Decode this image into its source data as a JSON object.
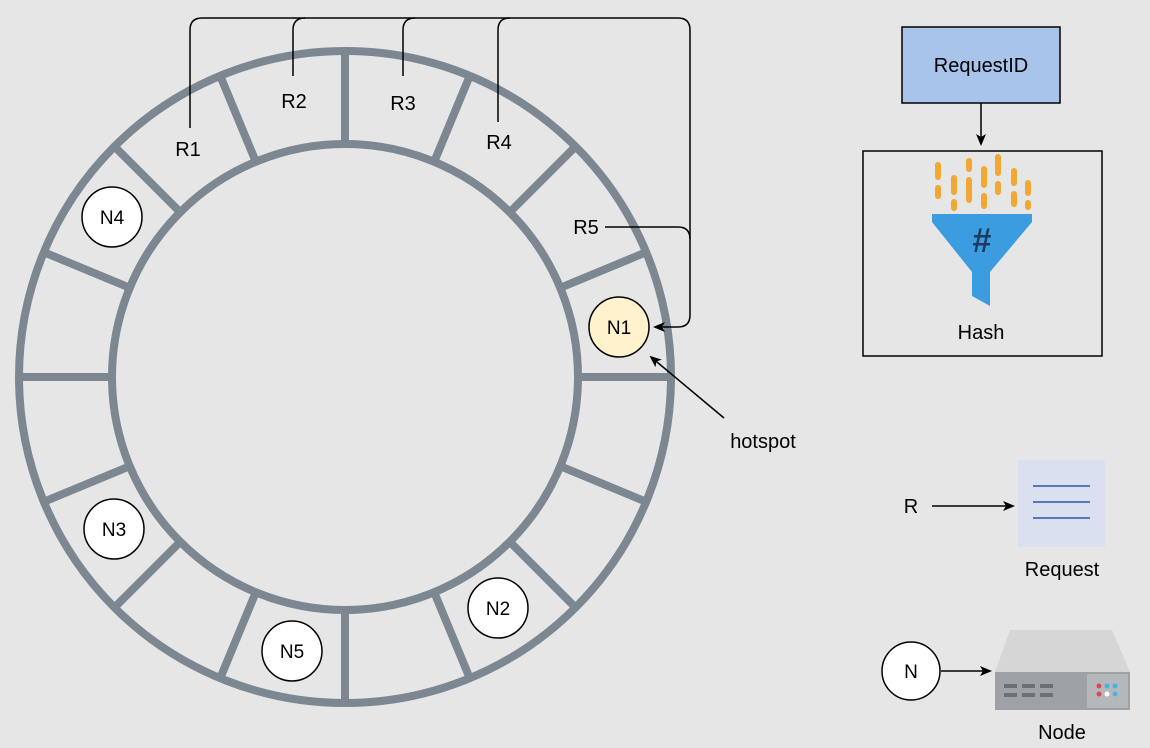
{
  "ring": {
    "segment_count": 16,
    "requests": [
      {
        "id": "r1",
        "label": "R1"
      },
      {
        "id": "r2",
        "label": "R2"
      },
      {
        "id": "r3",
        "label": "R3"
      },
      {
        "id": "r4",
        "label": "R4"
      },
      {
        "id": "r5",
        "label": "R5"
      }
    ],
    "nodes": [
      {
        "id": "n1",
        "label": "N1",
        "hot": true
      },
      {
        "id": "n2",
        "label": "N2",
        "hot": false
      },
      {
        "id": "n3",
        "label": "N3",
        "hot": false
      },
      {
        "id": "n4",
        "label": "N4",
        "hot": false
      },
      {
        "id": "n5",
        "label": "N5",
        "hot": false
      }
    ],
    "hotspot_label": "hotspot"
  },
  "legend": {
    "request_id_label": "RequestID",
    "hash_label": "Hash",
    "request_symbol": "R",
    "request_label": "Request",
    "node_symbol": "N",
    "node_label": "Node"
  },
  "colors": {
    "background": "#e6e6e6",
    "ring_stroke": "#7c8792",
    "hot_node_fill": "#fff2cc",
    "request_id_box": "#a9c4eb",
    "hash_funnel": "#3b9de0",
    "hash_bars": "#f0a830",
    "request_doc": "#dae0ef",
    "request_doc_lines": "#5577bb"
  },
  "icons": {
    "hash": "hash-funnel-icon",
    "request": "document-icon",
    "node": "server-icon"
  }
}
